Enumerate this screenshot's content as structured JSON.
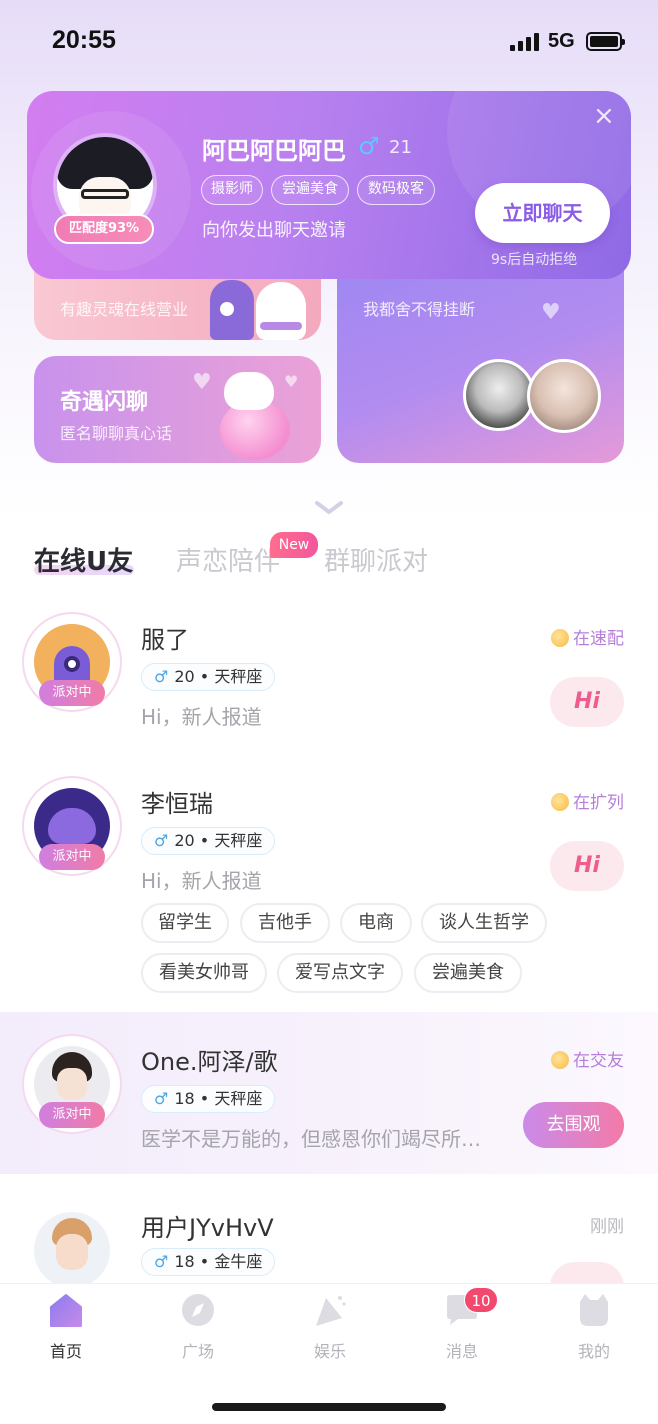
{
  "status_bar": {
    "time": "20:55",
    "network": "5G"
  },
  "invite": {
    "name": "阿巴阿巴阿巴",
    "gender_symbol": "♂",
    "age": "21",
    "match": "匹配度93%",
    "tags": [
      "摄影师",
      "尝遍美食",
      "数码极客"
    ],
    "message": "向你发出聊天邀请",
    "button_label": "立即聊天",
    "timer_text": "9s后自动拒绝",
    "close_symbol": "×"
  },
  "cards": {
    "voice": {
      "subtitle": "有趣灵魂在线营业"
    },
    "sound": {
      "subtitle": "我都舍不得挂断"
    },
    "chat": {
      "title": "奇遇闪聊",
      "subtitle": "匿名聊聊真心话"
    }
  },
  "tabs": {
    "online": "在线U友",
    "voice": "声恋陪伴",
    "group": "群聊派对",
    "new_badge": "New"
  },
  "users": [
    {
      "name": "服了",
      "gender_symbol": "♂",
      "info": "20 • 天秤座",
      "message": "Hi，新人报道",
      "status": "在速配",
      "badge": "派对中",
      "action": "Hi"
    },
    {
      "name": "李恒瑞",
      "gender_symbol": "♂",
      "info": "20 • 天秤座",
      "message": "Hi，新人报道",
      "status": "在扩列",
      "badge": "派对中",
      "action": "Hi",
      "interests": [
        "留学生",
        "吉他手",
        "电商",
        "谈人生哲学",
        "看美女帅哥",
        "爱写点文字",
        "尝遍美食"
      ]
    },
    {
      "name": "One.阿泽/歌",
      "gender_symbol": "♂",
      "info": "18 • 天秤座",
      "message": "医学不是万能的，但感恩你们竭尽所…",
      "status": "在交友",
      "badge": "派对中",
      "action": "去围观"
    },
    {
      "name": "用户JYvHvV",
      "gender_symbol": "♂",
      "info": "18 • 金牛座",
      "status": "刚刚"
    }
  ],
  "nav": {
    "items": [
      {
        "label": "首页",
        "icon": "home-icon"
      },
      {
        "label": "广场",
        "icon": "compass-icon"
      },
      {
        "label": "娱乐",
        "icon": "party-icon"
      },
      {
        "label": "消息",
        "icon": "chat-icon"
      },
      {
        "label": "我的",
        "icon": "profile-icon"
      }
    ],
    "message_count": "10"
  },
  "colors": {
    "accent": "#8a5be6",
    "pink": "#ee5d8e",
    "tab_active": "#2a2a33",
    "badge_red": "#f2496f"
  }
}
